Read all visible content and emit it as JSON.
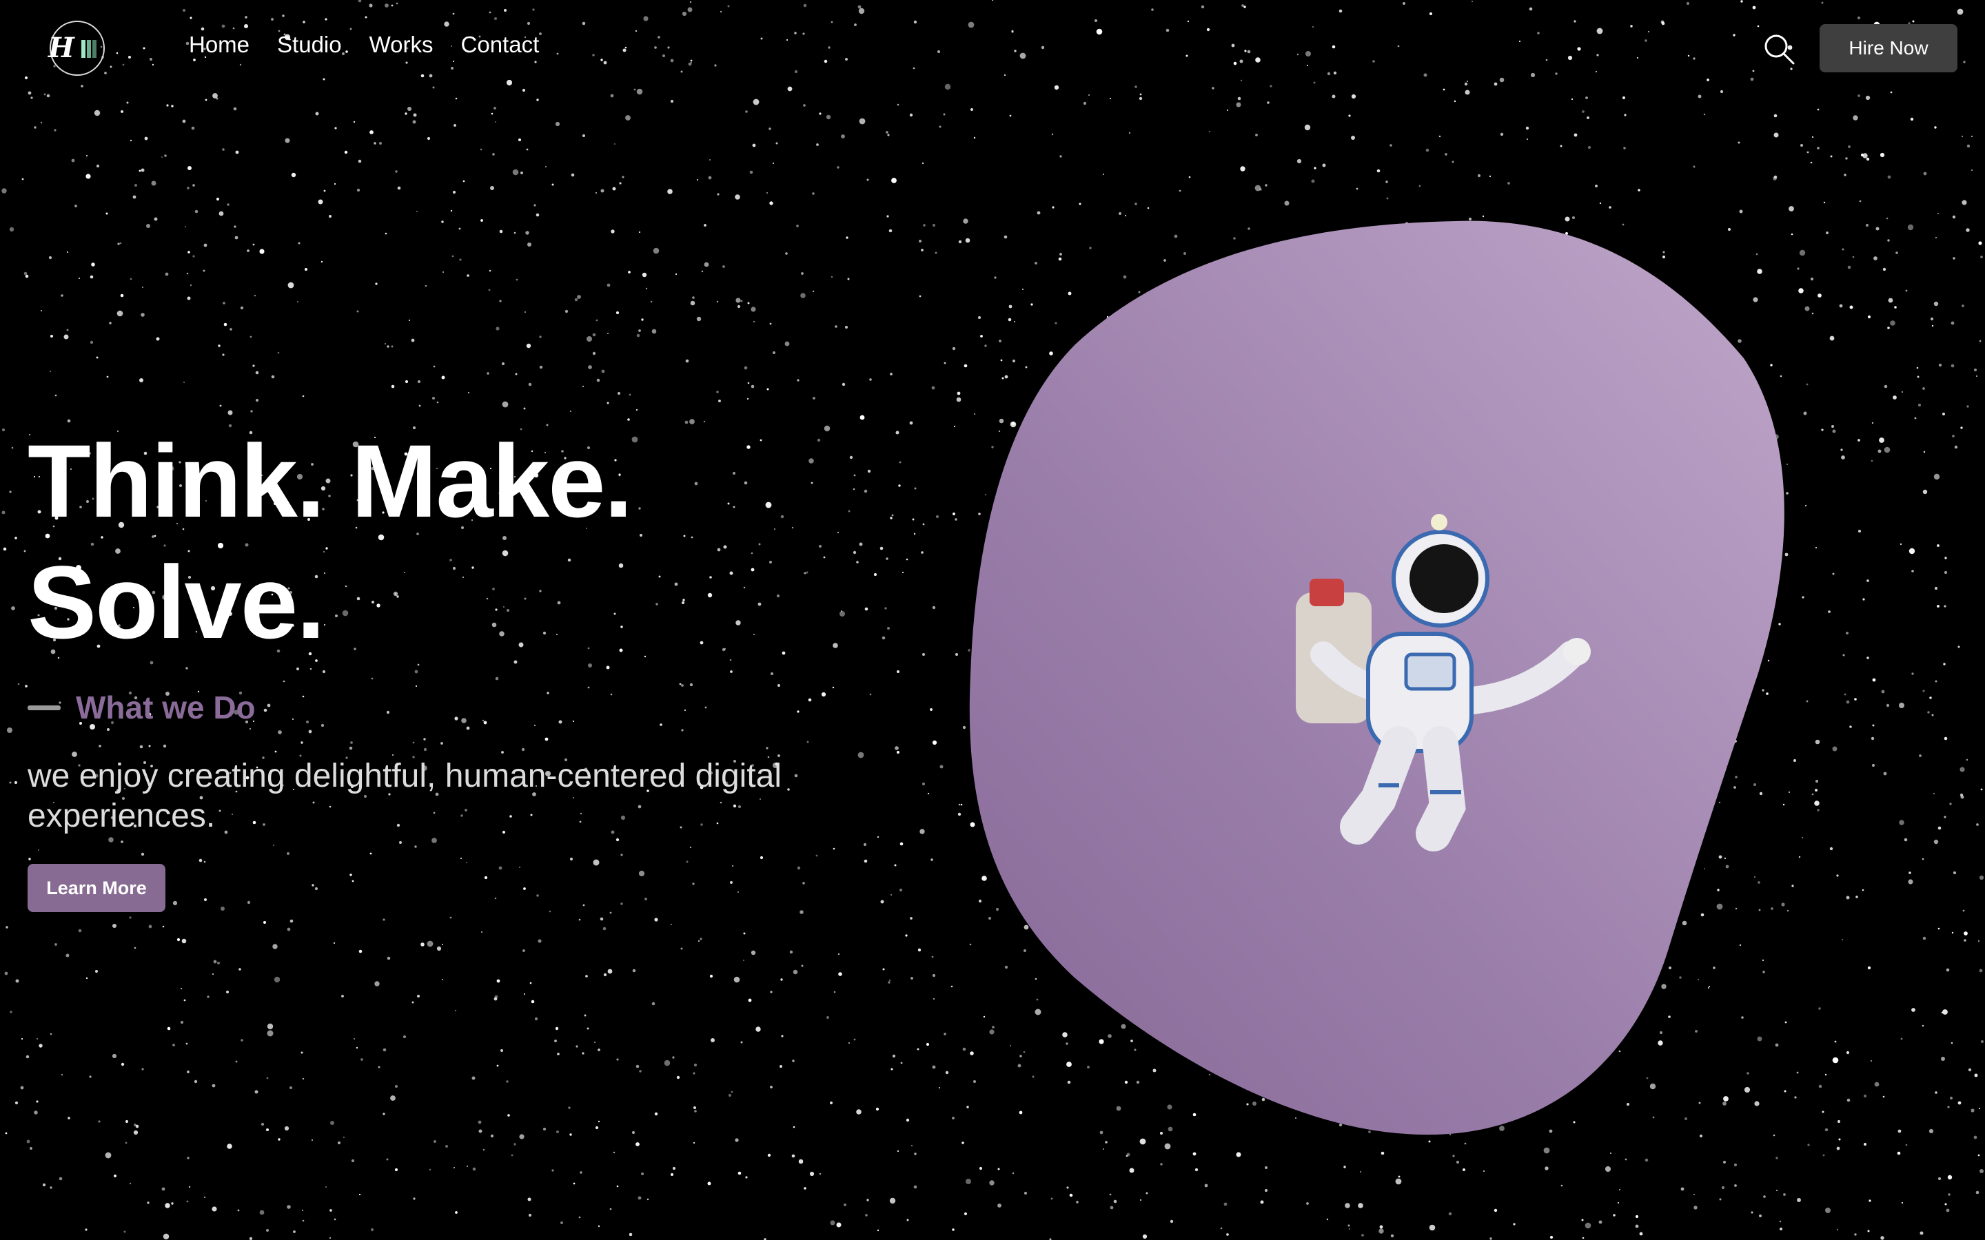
{
  "brand": {
    "logo_letter": "H",
    "colors": {
      "accent": "#876b93",
      "blob_light": "#bca2c6",
      "blob_dark": "#8a6c99"
    }
  },
  "nav": {
    "items": [
      {
        "label": "Home"
      },
      {
        "label": "Studio"
      },
      {
        "label": "Works"
      },
      {
        "label": "Contact"
      }
    ]
  },
  "header": {
    "search_icon": "search-icon",
    "hire_label": "Hire Now"
  },
  "hero": {
    "headline_line1": "Think. Make.",
    "headline_line2": "Solve.",
    "section_label": "What we Do",
    "description": "we enjoy creating delightful, human-centered digital experiences.",
    "cta_label": "Learn More"
  }
}
